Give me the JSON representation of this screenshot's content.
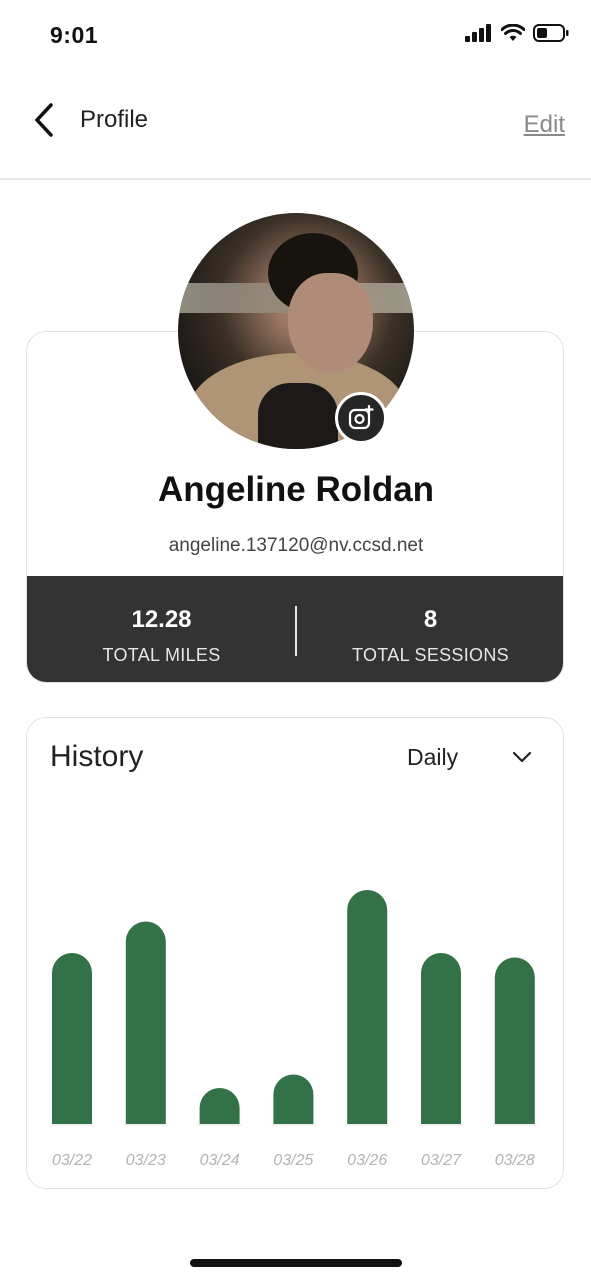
{
  "status_bar": {
    "time": "9:01"
  },
  "nav": {
    "title": "Profile",
    "edit_label": "Edit"
  },
  "profile": {
    "name": "Angeline Roldan",
    "email": "angeline.137120@nv.ccsd.net",
    "stats": [
      {
        "value": "12.28",
        "label": "TOTAL MILES"
      },
      {
        "value": "8",
        "label": "TOTAL SESSIONS"
      }
    ]
  },
  "history": {
    "title": "History",
    "period": "Daily"
  },
  "colors": {
    "bar": "#337147",
    "stats_bg": "#333333",
    "axis_label": "#b3b3b3"
  },
  "chart_data": {
    "type": "bar",
    "categories": [
      "03/22",
      "03/23",
      "03/24",
      "03/25",
      "03/26",
      "03/27",
      "03/28"
    ],
    "values": [
      1.9,
      2.25,
      0.4,
      0.55,
      2.6,
      1.9,
      1.85
    ],
    "title": "History",
    "xlabel": "",
    "ylabel": "",
    "ylim": [
      0,
      2.9
    ],
    "grid": false,
    "legend": "none"
  }
}
